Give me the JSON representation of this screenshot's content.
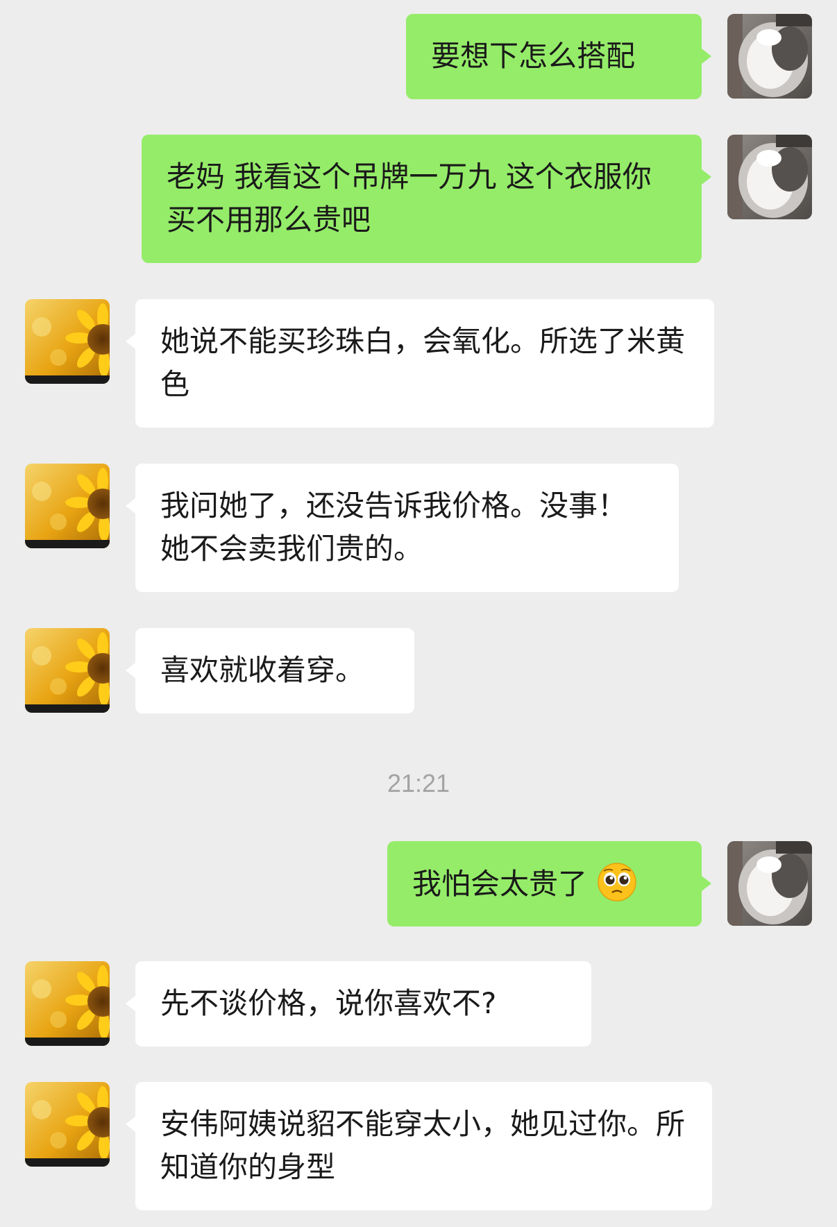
{
  "theme": {
    "background": "#ededed",
    "outgoing_bubble": "#95ec69",
    "incoming_bubble": "#ffffff",
    "timestamp_color": "#a3a3a3"
  },
  "messages": [
    {
      "direction": "outgoing",
      "avatar": "cat-avatar",
      "text": "要想下怎么搭配"
    },
    {
      "direction": "outgoing",
      "avatar": "cat-avatar",
      "text": "老妈 我看这个吊牌一万九 这个衣服你买不用那么贵吧"
    },
    {
      "direction": "incoming",
      "avatar": "sunflower-avatar",
      "text": "她说不能买珍珠白，会氧化。所选了米黄色"
    },
    {
      "direction": "incoming",
      "avatar": "sunflower-avatar",
      "text": "我问她了，还没告诉我价格。没事！她不会卖我们贵的。"
    },
    {
      "direction": "incoming",
      "avatar": "sunflower-avatar",
      "text": "喜欢就收着穿。"
    },
    {
      "direction": "outgoing",
      "avatar": "cat-avatar",
      "text": "我怕会太贵了",
      "emoji": "pleading-face-emoji"
    },
    {
      "direction": "incoming",
      "avatar": "sunflower-avatar",
      "text": "先不谈价格，说你喜欢不?"
    },
    {
      "direction": "incoming",
      "avatar": "sunflower-avatar",
      "text": "安伟阿姨说貂不能穿太小，她见过你。所知道你的身型"
    }
  ],
  "timestamp": "21:21"
}
